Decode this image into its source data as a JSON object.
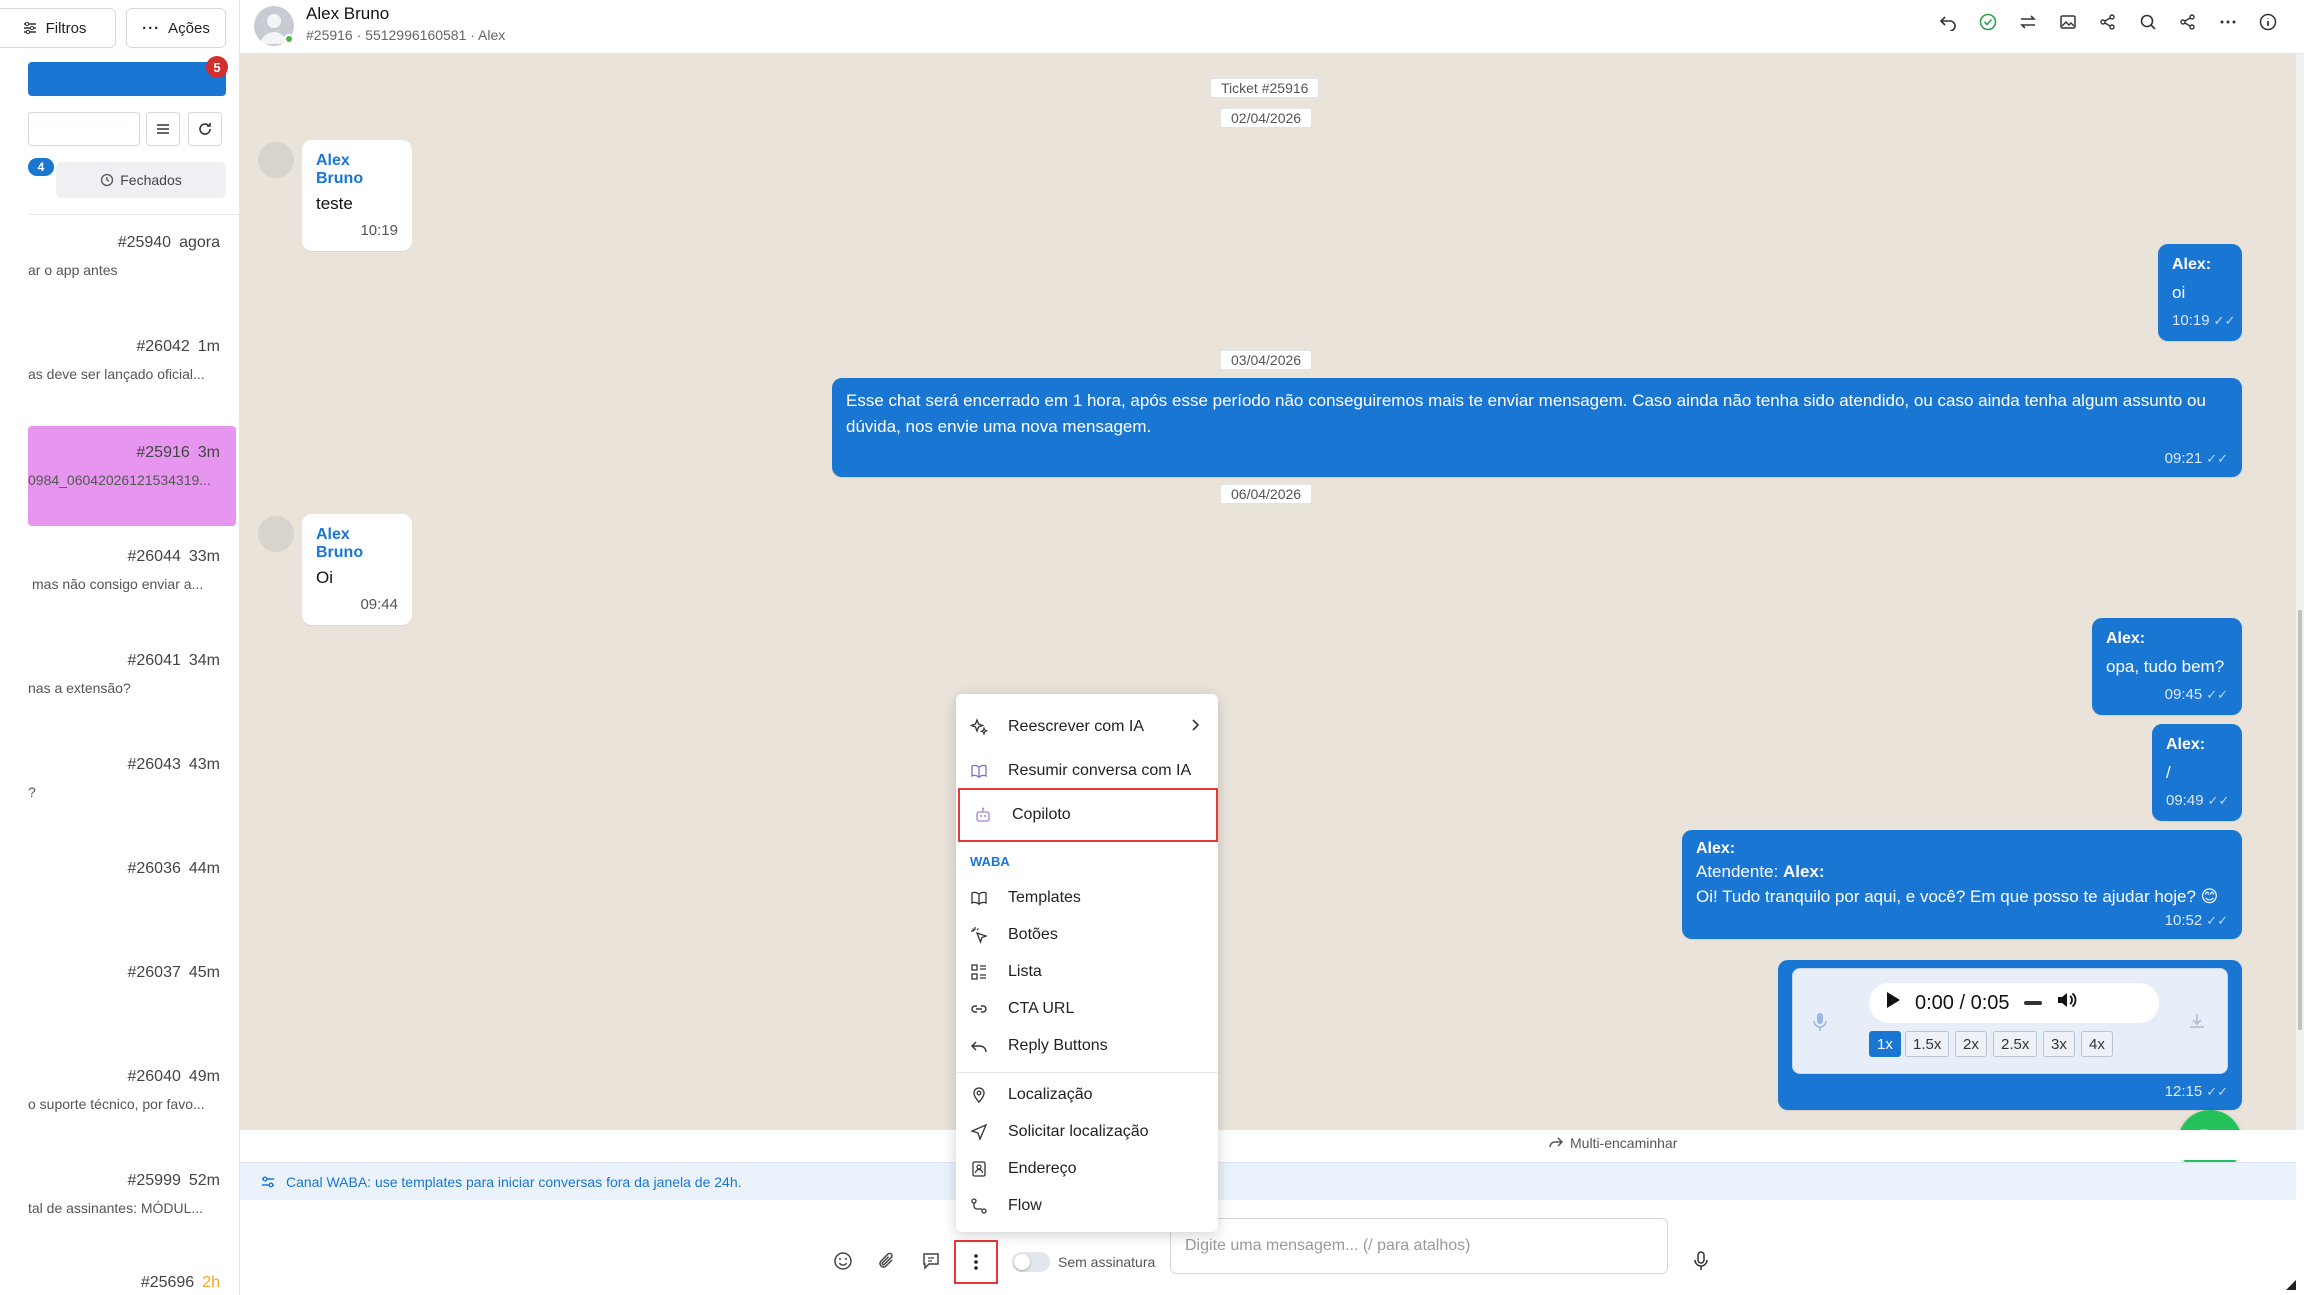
{
  "sidebar": {
    "filters_label": "Filtros",
    "actions_label": "Ações",
    "notification_count": "5",
    "open_count": "4",
    "closed_tab": "Fechados",
    "tickets": [
      {
        "id": "#25940",
        "time": "agora",
        "preview": "ar o app antes"
      },
      {
        "id": "#26042",
        "time": "1m",
        "preview": "as deve ser lançado oficial..."
      },
      {
        "id": "#25916",
        "time": "3m",
        "preview": "0984_06042026121534319..."
      },
      {
        "id": "#26044",
        "time": "33m",
        "preview": "mas não consigo enviar a..."
      },
      {
        "id": "#26041",
        "time": "34m",
        "preview": "nas a extensão?"
      },
      {
        "id": "#26043",
        "time": "43m",
        "preview": "?"
      },
      {
        "id": "#26036",
        "time": "44m",
        "preview": ""
      },
      {
        "id": "#26037",
        "time": "45m",
        "preview": ""
      },
      {
        "id": "#26040",
        "time": "49m",
        "preview": "o suporte técnico, por favo..."
      },
      {
        "id": "#25999",
        "time": "52m",
        "preview": "tal de assinantes: MÓDUL..."
      },
      {
        "id": "#25696",
        "time": "2h",
        "preview": ""
      }
    ]
  },
  "header": {
    "contact_name": "Alex Bruno",
    "contact_sub": "#25916 · 5512996160581 · Alex"
  },
  "chat": {
    "ticket_chip": "Ticket #25916",
    "dates": [
      "02/04/2026",
      "03/04/2026",
      "06/04/2026"
    ],
    "messages": [
      {
        "direction": "in",
        "sender": "Alex Bruno",
        "text": "teste",
        "time": "10:19"
      },
      {
        "direction": "out",
        "sender": "Alex:",
        "text": "oi",
        "time": "10:19"
      },
      {
        "direction": "out",
        "sender": "",
        "text": "Esse chat será encerrado em 1 hora, após esse período não conseguiremos mais te enviar mensagem. Caso ainda não tenha sido atendido, ou caso ainda tenha algum assunto ou dúvida, nos envie uma nova mensagem.",
        "time": "09:21"
      },
      {
        "direction": "in",
        "sender": "Alex Bruno",
        "text": "Oi",
        "time": "09:44"
      },
      {
        "direction": "out",
        "sender": "Alex:",
        "text": "opa, tudo bem?",
        "time": "09:45"
      },
      {
        "direction": "out",
        "sender": "Alex:",
        "text": "/",
        "time": "09:49"
      },
      {
        "direction": "out",
        "sender": "Alex:",
        "line2_prefix": "Atendente: ",
        "line2_name": "Alex:",
        "text": "Oi! Tudo tranquilo por aqui, e você? Em que posso te ajudar hoje? 😊",
        "time": "10:52"
      }
    ],
    "audio": {
      "time": "0:00 / 0:05",
      "speeds": [
        "1x",
        "1.5x",
        "2x",
        "2.5x",
        "3x",
        "4x"
      ],
      "selected_speed": "1x",
      "message_time": "12:15"
    }
  },
  "menu": {
    "items_top": [
      {
        "label": "Reescrever com IA",
        "icon": "sparkles-icon",
        "has_submenu": true
      },
      {
        "label": "Resumir conversa com IA",
        "icon": "book-open-icon"
      },
      {
        "label": "Copiloto",
        "icon": "robot-icon"
      }
    ],
    "section_label": "WABA",
    "items_waba": [
      {
        "label": "Templates",
        "icon": "book-icon"
      },
      {
        "label": "Botões",
        "icon": "click-icon"
      },
      {
        "label": "Lista",
        "icon": "list-icon"
      },
      {
        "label": "CTA URL",
        "icon": "link-icon"
      },
      {
        "label": "Reply Buttons",
        "icon": "reply-icon"
      }
    ],
    "items_bottom": [
      {
        "label": "Localização",
        "icon": "map-pin-icon"
      },
      {
        "label": "Solicitar localização",
        "icon": "navigation-icon"
      },
      {
        "label": "Endereço",
        "icon": "address-book-icon"
      },
      {
        "label": "Flow",
        "icon": "flow-icon"
      }
    ]
  },
  "footer": {
    "multi_forward": "Multi-encaminhar",
    "waba_notice": "Canal WABA: use templates para iniciar conversas fora da janela de 24h.",
    "signature_label": "Sem assinatura",
    "input_placeholder": "Digite uma mensagem... (/ para atalhos)"
  },
  "colors": {
    "primary": "#1976d2",
    "active_ticket": "#e796f0",
    "highlight_border": "#e53935",
    "call_button": "#25c15a",
    "chat_background": "#e9e3da"
  }
}
